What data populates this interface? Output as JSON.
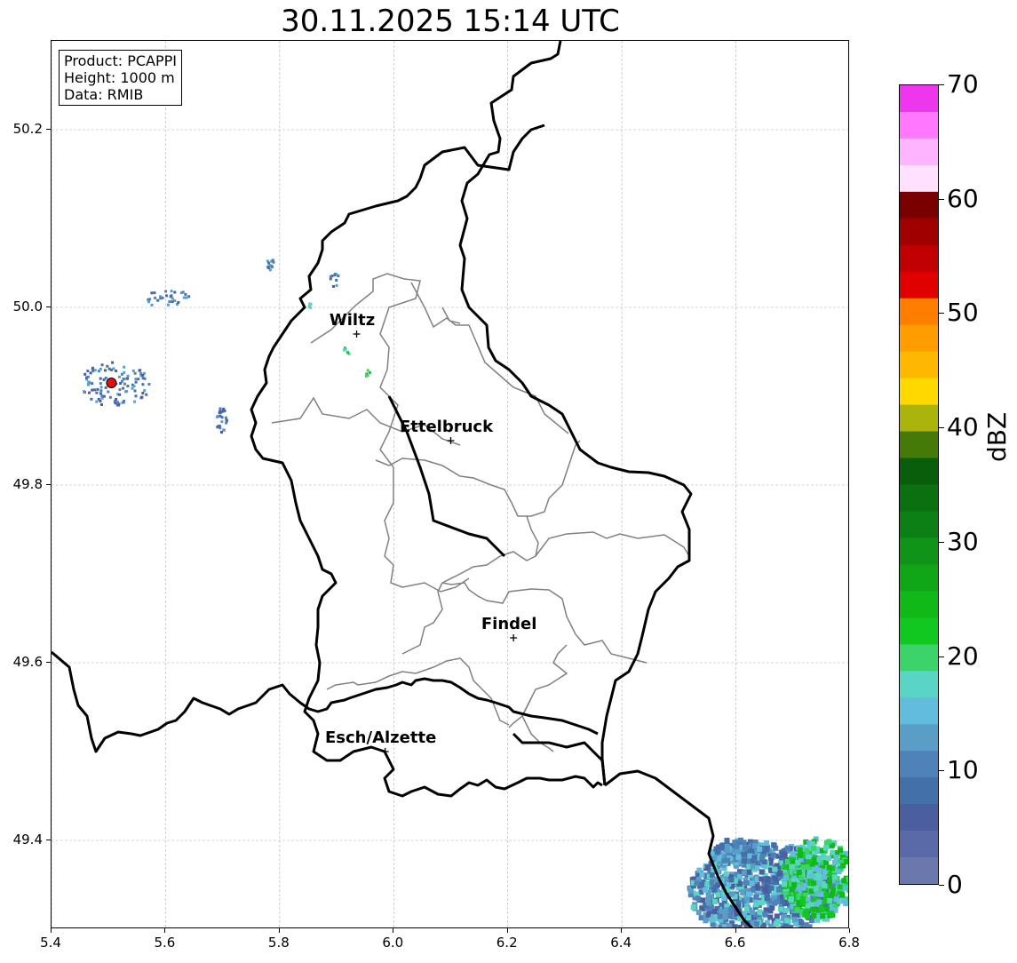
{
  "title": "30.11.2025 15:14 UTC",
  "info": {
    "product": "Product: PCAPPI",
    "height": "Height: 1000 m",
    "data": "Data: RMIB"
  },
  "axes": {
    "lon_ticks": [
      "5.4",
      "5.6",
      "5.8",
      "6.0",
      "6.2",
      "6.4",
      "6.6",
      "6.8"
    ],
    "lat_ticks": [
      "50.2",
      "50.0",
      "49.8",
      "49.6",
      "49.4"
    ]
  },
  "extent": {
    "lon_min": 5.4,
    "lon_max": 6.8,
    "lat_min": 49.3,
    "lat_max": 50.3
  },
  "cities": [
    {
      "name": "Wiltz",
      "lon": 5.935,
      "lat": 49.97
    },
    {
      "name": "Ettelbruck",
      "lon": 6.1,
      "lat": 49.85
    },
    {
      "name": "Findel",
      "lon": 6.21,
      "lat": 49.628
    },
    {
      "name": "Esch/Alzette",
      "lon": 5.985,
      "lat": 49.5
    }
  ],
  "radar_site": {
    "lon": 5.505,
    "lat": 49.915,
    "color": "#e01010"
  },
  "colorbar": {
    "label": "dBZ",
    "ticks": [
      "0",
      "10",
      "20",
      "30",
      "40",
      "50",
      "60",
      "70"
    ],
    "min": 0,
    "max": 70,
    "colors": [
      "#6a78ad",
      "#5a6aa8",
      "#4a5ea0",
      "#4470aa",
      "#4f82b8",
      "#5a9ec8",
      "#62bcdc",
      "#5ad4c4",
      "#3cd46a",
      "#10c820",
      "#10b818",
      "#10a618",
      "#109418",
      "#0c8014",
      "#0a7010",
      "#085e0a",
      "#467a08",
      "#aab40a",
      "#ffd800",
      "#ffb800",
      "#ff9c00",
      "#ff7e00",
      "#e00000",
      "#c00000",
      "#a00000",
      "#7a0000",
      "#ffe0ff",
      "#ffb4ff",
      "#ff78ff",
      "#ee36ee"
    ]
  }
}
